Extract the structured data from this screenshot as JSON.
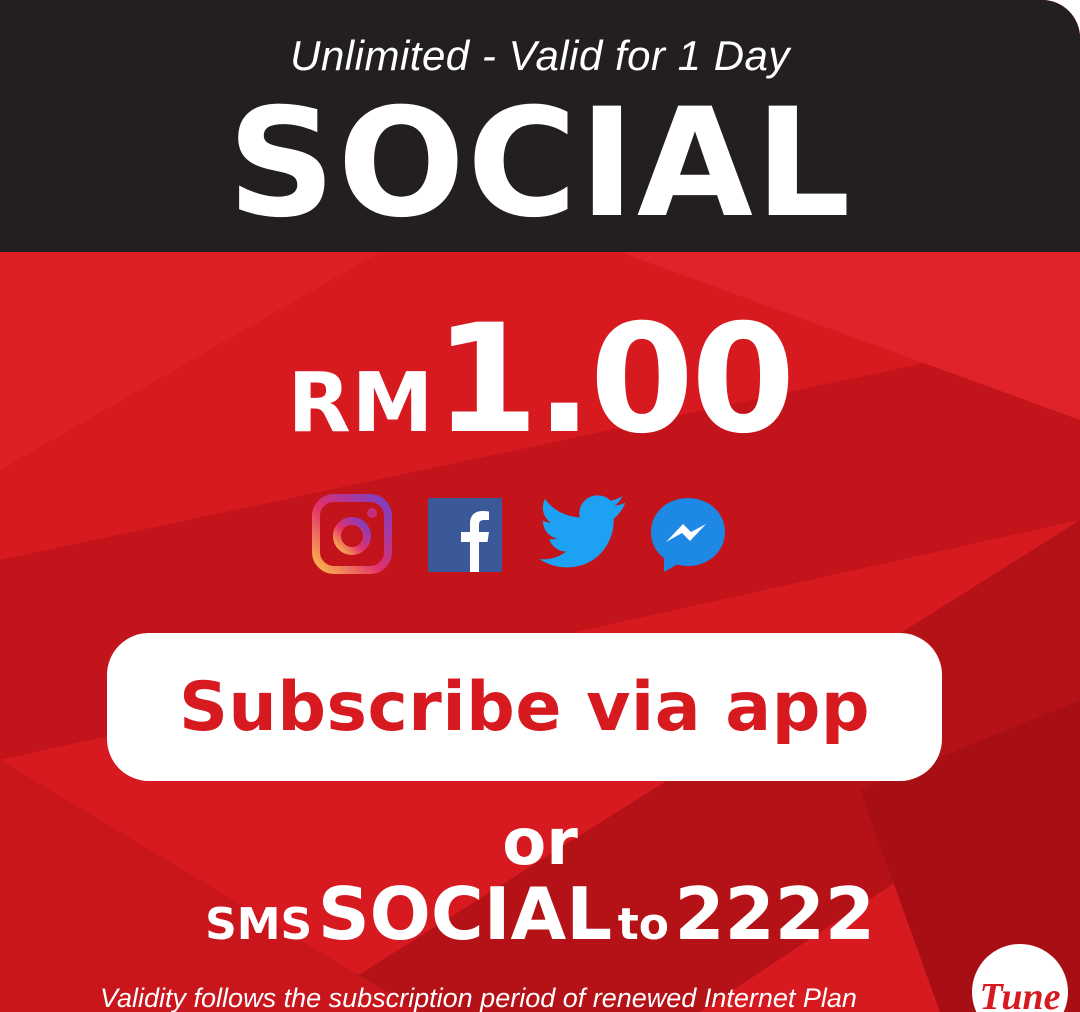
{
  "header": {
    "validity": "Unlimited - Valid for 1 Day",
    "title": "SOCIAL"
  },
  "price": {
    "currency": "RM",
    "amount": "1.00"
  },
  "social_icons": [
    "instagram-icon",
    "facebook-icon",
    "twitter-icon",
    "messenger-icon"
  ],
  "cta": {
    "subscribe_label": "Subscribe via app",
    "or_label": "or",
    "sms_prefix": "SMS",
    "sms_keyword": "SOCIAL",
    "sms_to": "to",
    "sms_number": "2222"
  },
  "footnote": "Validity follows the subscription period of renewed Internet Plan",
  "logo": {
    "brand": "Tune"
  },
  "colors": {
    "brand_red": "#d71920",
    "header_black": "#231f20",
    "text_white": "#ffffff"
  }
}
